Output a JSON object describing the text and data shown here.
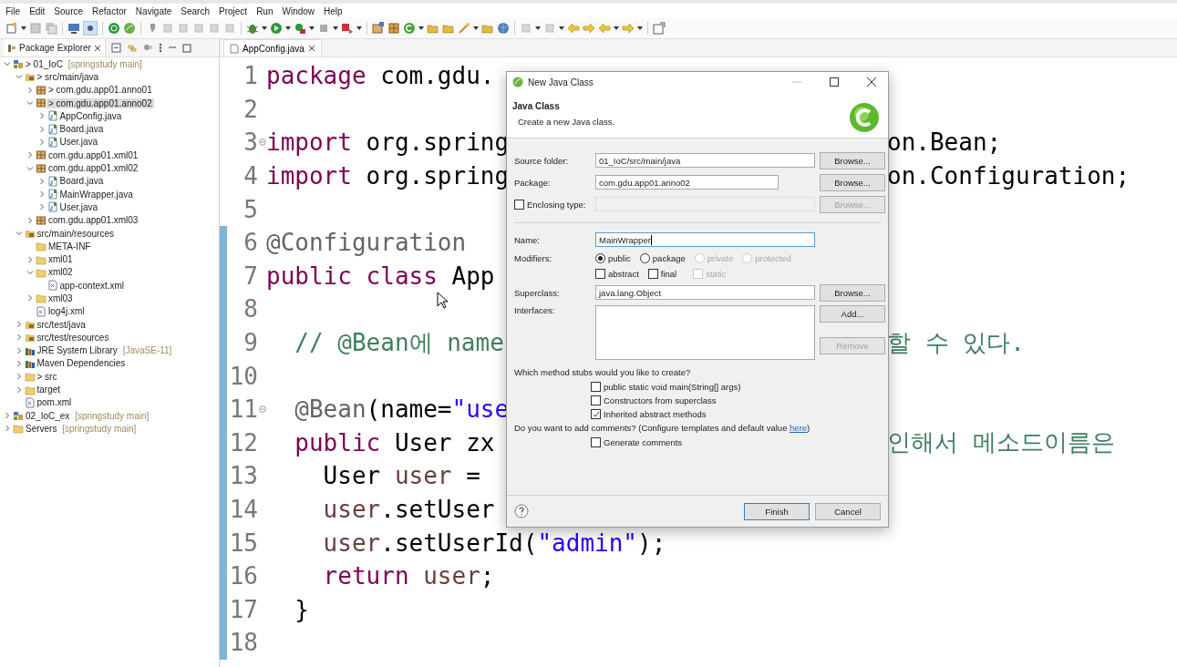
{
  "menu": [
    "File",
    "Edit",
    "Source",
    "Refactor",
    "Navigate",
    "Search",
    "Project",
    "Run",
    "Window",
    "Help"
  ],
  "explorer": {
    "title": "Package Explorer",
    "tree": [
      {
        "label": "> 01_IoC",
        "suffix": "[springstudy main]",
        "kind": "project",
        "expanded": true,
        "selected": false,
        "children": [
          {
            "label": "> src/main/java",
            "kind": "srcfolder",
            "expanded": true,
            "selected": false,
            "children": [
              {
                "label": "> com.gdu.app01.anno01",
                "kind": "package",
                "expanded": false,
                "selected": false
              },
              {
                "label": "> com.gdu.app01.anno02",
                "kind": "package",
                "expanded": true,
                "selected": true,
                "children": [
                  {
                    "label": "AppConfig.java",
                    "kind": "java",
                    "expanded": false,
                    "selected": false
                  },
                  {
                    "label": "Board.java",
                    "kind": "java",
                    "expanded": false,
                    "selected": false
                  },
                  {
                    "label": "User.java",
                    "kind": "java",
                    "expanded": false,
                    "selected": false
                  }
                ]
              },
              {
                "label": "com.gdu.app01.xml01",
                "kind": "package",
                "expanded": false,
                "selected": false
              },
              {
                "label": "com.gdu.app01.xml02",
                "kind": "package",
                "expanded": true,
                "selected": false,
                "children": [
                  {
                    "label": "Board.java",
                    "kind": "java",
                    "expanded": false,
                    "selected": false
                  },
                  {
                    "label": "MainWrapper.java",
                    "kind": "java",
                    "expanded": false,
                    "selected": false
                  },
                  {
                    "label": "User.java",
                    "kind": "java",
                    "expanded": false,
                    "selected": false
                  }
                ]
              },
              {
                "label": "com.gdu.app01.xml03",
                "kind": "package",
                "expanded": false,
                "selected": false
              }
            ]
          },
          {
            "label": "src/main/resources",
            "kind": "srcfolder",
            "expanded": true,
            "selected": false,
            "children": [
              {
                "label": "META-INF",
                "kind": "folder",
                "selected": false
              },
              {
                "label": "xml01",
                "kind": "folder",
                "expanded": false,
                "selected": false
              },
              {
                "label": "xml02",
                "kind": "folder",
                "expanded": true,
                "selected": false,
                "children": [
                  {
                    "label": "app-context.xml",
                    "kind": "xml",
                    "selected": false
                  }
                ]
              },
              {
                "label": "xml03",
                "kind": "folder",
                "expanded": false,
                "selected": false
              },
              {
                "label": "log4j.xml",
                "kind": "xml",
                "selected": false
              }
            ]
          },
          {
            "label": "src/test/java",
            "kind": "srcfolder",
            "expanded": false,
            "selected": false
          },
          {
            "label": "src/test/resources",
            "kind": "srcfolder",
            "expanded": false,
            "selected": false
          },
          {
            "label": "JRE System Library",
            "suffix": "[JavaSE-11]",
            "kind": "library",
            "expanded": false,
            "selected": false
          },
          {
            "label": "Maven Dependencies",
            "kind": "library",
            "expanded": false,
            "selected": false
          },
          {
            "label": "> src",
            "kind": "folder",
            "expanded": false,
            "selected": false
          },
          {
            "label": "target",
            "kind": "folder",
            "expanded": false,
            "selected": false
          },
          {
            "label": "pom.xml",
            "kind": "xml",
            "selected": false
          }
        ]
      },
      {
        "label": "02_IoC_ex",
        "suffix": "[springstudy main]",
        "kind": "project",
        "expanded": false,
        "selected": false
      },
      {
        "label": "Servers",
        "suffix": "[springstudy main]",
        "kind": "folder",
        "expanded": false,
        "selected": false
      }
    ]
  },
  "editor": {
    "tab": "AppConfig.java",
    "lines": [
      {
        "number": "1",
        "changed": false,
        "code": [
          {
            "text": "package",
            "kind": "keyword"
          },
          {
            "text": " com.gdu.",
            "kind": "plain"
          }
        ]
      },
      {
        "number": "2",
        "changed": false
      },
      {
        "number": "3",
        "changed": false,
        "foldable": true,
        "code": [
          {
            "text": "import",
            "kind": "keyword"
          },
          {
            "text": " org.spring",
            "kind": "plain"
          }
        ],
        "right": [
          {
            "text": "on.Bean;",
            "kind": "plain"
          }
        ]
      },
      {
        "number": "4",
        "changed": false,
        "code": [
          {
            "text": "import",
            "kind": "keyword"
          },
          {
            "text": " org.spring",
            "kind": "plain"
          }
        ],
        "right": [
          {
            "text": "on.Configuration;",
            "kind": "plain"
          }
        ]
      },
      {
        "number": "5",
        "changed": false
      },
      {
        "number": "6",
        "changed": true,
        "code": [
          {
            "text": "@Configuration",
            "kind": "annotation"
          }
        ]
      },
      {
        "number": "7",
        "changed": true,
        "code": [
          {
            "text": "public class",
            "kind": "keyword"
          },
          {
            "text": " App",
            "kind": "plain"
          }
        ]
      },
      {
        "number": "8",
        "changed": true
      },
      {
        "number": "9",
        "changed": true,
        "code": [
          {
            "text": "  // @Bean에 name",
            "kind": "comment"
          }
        ],
        "right": [
          {
            "text": "할 수 있다.",
            "kind": "comment"
          }
        ]
      },
      {
        "number": "10",
        "changed": true
      },
      {
        "number": "11",
        "changed": true,
        "foldable": true,
        "code": [
          {
            "text": "  @Bean",
            "kind": "annotation"
          },
          {
            "text": "(name=",
            "kind": "plain"
          },
          {
            "text": "\"use",
            "kind": "string"
          }
        ]
      },
      {
        "number": "12",
        "changed": true,
        "code": [
          {
            "text": "  public",
            "kind": "keyword"
          },
          {
            "text": " User zx",
            "kind": "plain"
          }
        ],
        "right": [
          {
            "text": "인해서 메소드이름은",
            "kind": "comment"
          }
        ]
      },
      {
        "number": "13",
        "changed": true,
        "code": [
          {
            "text": "    User ",
            "kind": "plain"
          },
          {
            "text": "user",
            "kind": "variable"
          },
          {
            "text": " =",
            "kind": "plain"
          }
        ]
      },
      {
        "number": "14",
        "changed": true,
        "code": [
          {
            "text": "    user",
            "kind": "variable"
          },
          {
            "text": ".setUser",
            "kind": "plain"
          }
        ]
      },
      {
        "number": "15",
        "changed": true,
        "code": [
          {
            "text": "    user",
            "kind": "variable"
          },
          {
            "text": ".setUserId(",
            "kind": "plain"
          },
          {
            "text": "\"admin\"",
            "kind": "string"
          },
          {
            "text": ");",
            "kind": "plain"
          }
        ]
      },
      {
        "number": "16",
        "changed": true,
        "code": [
          {
            "text": "    return",
            "kind": "keyword"
          },
          {
            "text": " user",
            "kind": "variable"
          },
          {
            "text": ";",
            "kind": "plain"
          }
        ]
      },
      {
        "number": "17",
        "changed": true,
        "code": [
          {
            "text": "  }",
            "kind": "plain"
          }
        ]
      },
      {
        "number": "18",
        "changed": true
      }
    ]
  },
  "dialog": {
    "title": "New Java Class",
    "heading": "Java Class",
    "subtitle": "Create a new Java class.",
    "source_folder": {
      "label": "Source folder:",
      "value": "01_IoC/src/main/java",
      "button": "Browse..."
    },
    "package": {
      "label": "Package:",
      "value": "com.gdu.app01.anno02",
      "button": "Browse..."
    },
    "enclosing_type": {
      "label": "Enclosing type:",
      "checked": false,
      "disabled": true,
      "button": "Browse..."
    },
    "name": {
      "label": "Name:",
      "value": "MainWrapper"
    },
    "modifiers": {
      "label": "Modifiers:",
      "access": [
        {
          "label": "public",
          "selected": true,
          "disabled": false
        },
        {
          "label": "package",
          "selected": false,
          "disabled": false
        },
        {
          "label": "private",
          "selected": false,
          "disabled": true
        },
        {
          "label": "protected",
          "selected": false,
          "disabled": true
        }
      ],
      "flags": [
        {
          "label": "abstract",
          "checked": false,
          "disabled": false
        },
        {
          "label": "final",
          "checked": false,
          "disabled": false
        },
        {
          "label": "static",
          "checked": false,
          "disabled": true
        }
      ]
    },
    "superclass": {
      "label": "Superclass:",
      "value": "java.lang.Object",
      "button": "Browse..."
    },
    "interfaces": {
      "label": "Interfaces:",
      "buttons": [
        {
          "label": "Add...",
          "disabled": false
        },
        {
          "label": "Remove",
          "disabled": true
        }
      ]
    },
    "stubs": {
      "question": "Which method stubs would you like to create?",
      "options": [
        {
          "label": "public static void main(String[] args)",
          "checked": false
        },
        {
          "label": "Constructors from superclass",
          "checked": false
        },
        {
          "label": "Inherited abstract methods",
          "checked": true
        }
      ]
    },
    "comments": {
      "question": "Do you want to add comments? (Configure templates and default value ",
      "link": "here",
      "tail": ")",
      "options": [
        {
          "label": "Generate comments",
          "checked": false
        }
      ]
    },
    "buttons": [
      {
        "label": "Finish",
        "default": true
      },
      {
        "label": "Cancel",
        "default": false
      }
    ]
  }
}
